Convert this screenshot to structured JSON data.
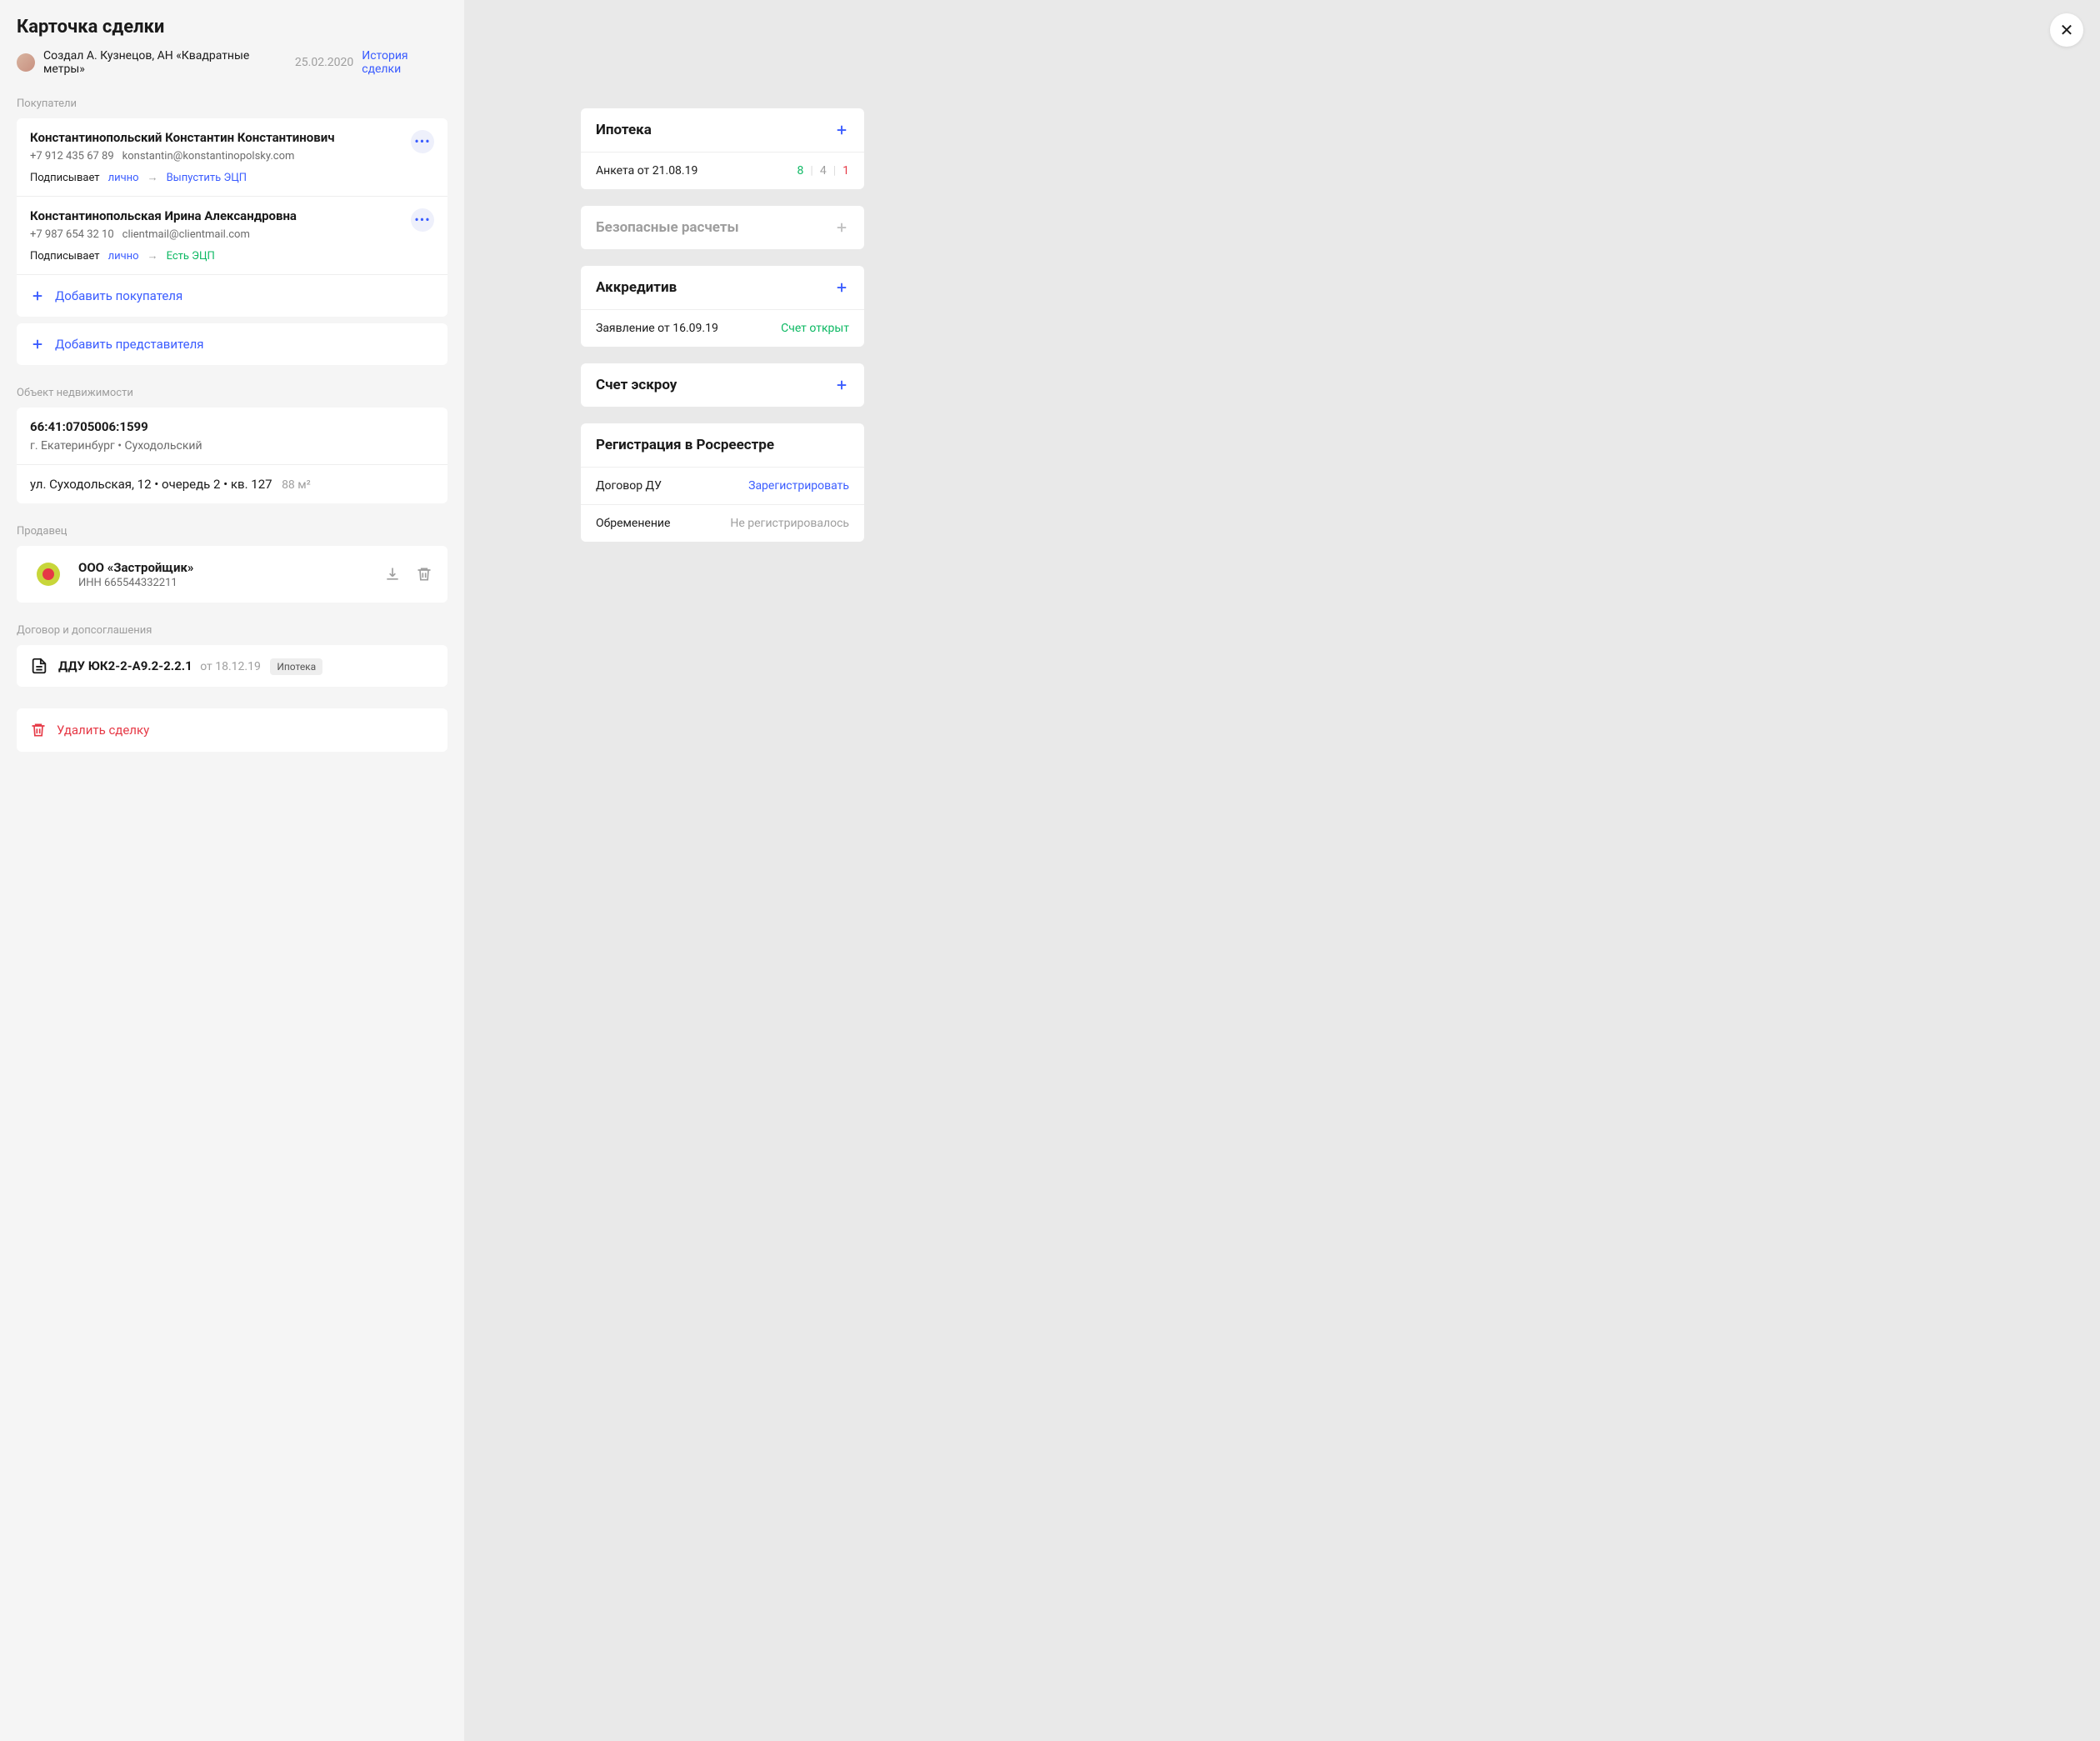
{
  "title": "Карточка сделки",
  "creator": "Создал А. Кузнецов, АН «Квадратные метры»",
  "date": "25.02.2020",
  "history_link": "История сделки",
  "labels": {
    "buyers": "Покупатели",
    "property": "Объект недвижимости",
    "seller": "Продавец",
    "contracts": "Договор и допсоглашения"
  },
  "buyers": [
    {
      "name": "Константинопольский Константин Константинович",
      "phone": "+7 912 435 67 89",
      "email": "konstantin@konstantinopolsky.com",
      "sign_label": "Подписывает",
      "sign_mode": "лично",
      "ecp_label": "Выпустить ЭЦП",
      "ecp_has": false
    },
    {
      "name": "Константинопольская Ирина Александровна",
      "phone": "+7 987 654 32 10",
      "email": "clientmail@clientmail.com",
      "sign_label": "Подписывает",
      "sign_mode": "лично",
      "ecp_label": "Есть ЭЦП",
      "ecp_has": true
    }
  ],
  "add_buyer": "Добавить покупателя",
  "add_rep": "Добавить представителя",
  "property": {
    "cadastral": "66:41:0705006:1599",
    "city": "г. Екатеринбург • Суходольский",
    "address": "ул. Суходольская, 12 • очередь 2 • кв. 127",
    "area": "88 м²"
  },
  "seller": {
    "name": "ООО «Застройщик»",
    "inn": "ИНН 665544332211"
  },
  "contract": {
    "number": "ДДУ ЮК2-2-A9.2-2.2.1",
    "date": "от 18.12.19",
    "tag": "Ипотека"
  },
  "delete_deal": "Удалить сделку",
  "panels": {
    "mortgage": {
      "title": "Ипотека",
      "row_label": "Анкета от 21.08.19",
      "stats": {
        "g": "8",
        "n": "4",
        "r": "1"
      }
    },
    "safe": {
      "title": "Безопасные расчеты"
    },
    "accred": {
      "title": "Аккредитив",
      "row_label": "Заявление от 16.09.19",
      "status": "Счет открыт"
    },
    "escrow": {
      "title": "Счет эскроу"
    },
    "rosreestr": {
      "title": "Регистрация в Росреестре",
      "rows": [
        {
          "label": "Договор ДУ",
          "action": "Зарегистрировать",
          "type": "link"
        },
        {
          "label": "Обременение",
          "action": "Не регистрировалось",
          "type": "gray"
        }
      ]
    }
  }
}
